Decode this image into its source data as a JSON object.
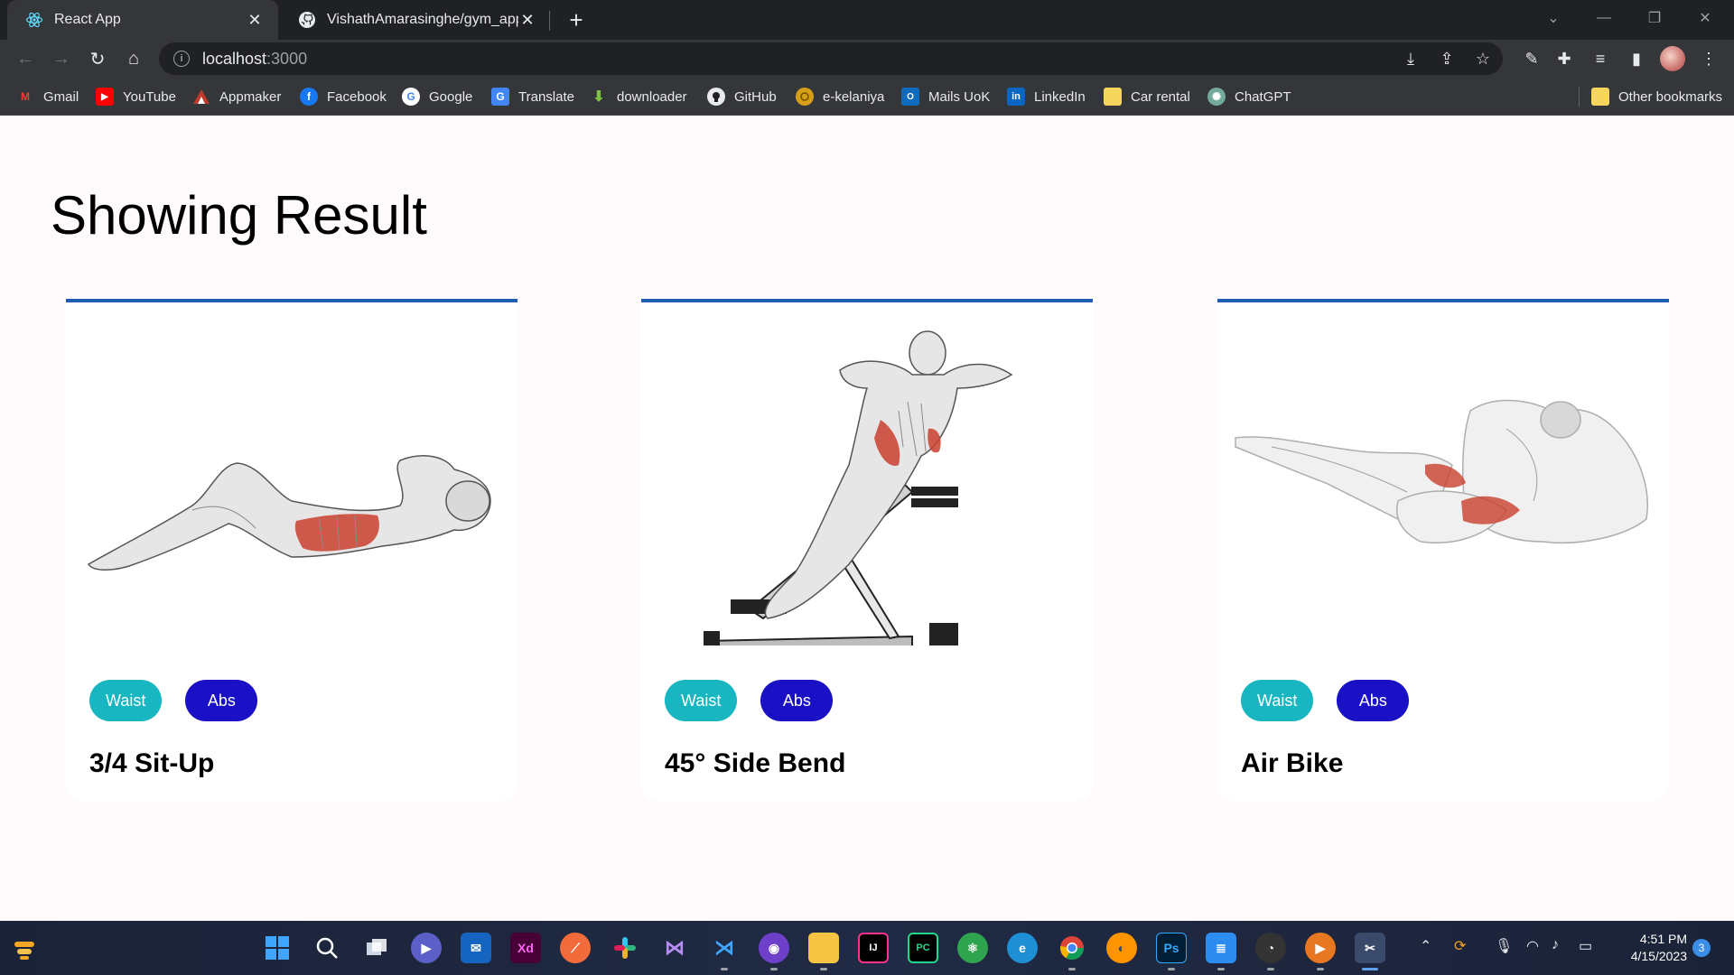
{
  "browser": {
    "tabs": [
      {
        "title": "React App",
        "active": true
      },
      {
        "title": "VishathAmarasinghe/gym_app: T",
        "active": false
      }
    ],
    "address": {
      "host": "localhost",
      "port": ":3000"
    },
    "bookmarks": [
      {
        "label": "Gmail",
        "icon": "gmail-icon"
      },
      {
        "label": "YouTube",
        "icon": "youtube-icon"
      },
      {
        "label": "Appmaker",
        "icon": "appmaker-icon"
      },
      {
        "label": "Facebook",
        "icon": "facebook-icon"
      },
      {
        "label": "Google",
        "icon": "google-icon"
      },
      {
        "label": "Translate",
        "icon": "translate-icon"
      },
      {
        "label": "downloader",
        "icon": "download-icon"
      },
      {
        "label": "GitHub",
        "icon": "github-icon"
      },
      {
        "label": "e-kelaniya",
        "icon": "e-kelaniya-icon"
      },
      {
        "label": "Mails UoK",
        "icon": "outlook-icon"
      },
      {
        "label": "LinkedIn",
        "icon": "linkedin-icon"
      },
      {
        "label": "Car rental",
        "icon": "folder-icon"
      },
      {
        "label": "ChatGPT",
        "icon": "chatgpt-icon"
      }
    ],
    "other_bookmarks": "Other bookmarks"
  },
  "page": {
    "title": "Showing Result",
    "cards": [
      {
        "tags": [
          "Waist",
          "Abs"
        ],
        "name": "3/4 Sit-Up"
      },
      {
        "tags": [
          "Waist",
          "Abs"
        ],
        "name": "45° Side Bend"
      },
      {
        "tags": [
          "Waist",
          "Abs"
        ],
        "name": "Air Bike"
      }
    ]
  },
  "colors": {
    "card_border": "#1e5fb4",
    "tag_waist": "#17b6c0",
    "tag_abs": "#1a10c6",
    "page_bg": "#fffafb"
  },
  "taskbar": {
    "time": "4:51 PM",
    "date": "4/15/2023",
    "notification_count": "3"
  }
}
